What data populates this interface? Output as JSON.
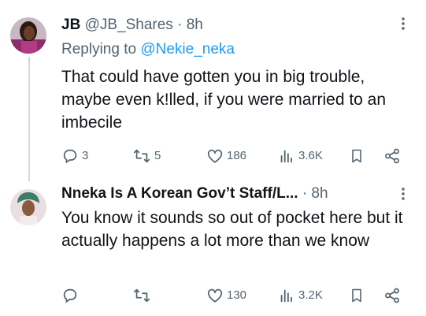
{
  "tweets": [
    {
      "display_name": "JB",
      "handle": "@JB_Shares",
      "time": "· 8h",
      "replying_prefix": "Replying to",
      "replying_to": "@Nekie_neka",
      "text": "That could have gotten you in big trouble, maybe even k!lled, if you were married to an imbecile",
      "actions": {
        "replies": "3",
        "retweets": "5",
        "likes": "186",
        "views": "3.6K"
      }
    },
    {
      "display_name": "Nneka Is A Korean Gov’t Staff/L...",
      "time": "· 8h",
      "text": "You know it sounds so out of pocket here but it actually happens a lot more than we know",
      "actions": {
        "likes": "130",
        "views": "3.2K"
      }
    }
  ],
  "icons": {
    "reply": "reply-icon",
    "retweet": "retweet-icon",
    "like": "heart-icon",
    "views": "views-icon",
    "bookmark": "bookmark-icon",
    "share": "share-icon",
    "more": "more-icon"
  },
  "colors": {
    "text": "#0f1419",
    "muted": "#536471",
    "link": "#1d9bf0",
    "thread_line": "#cfd9de"
  }
}
